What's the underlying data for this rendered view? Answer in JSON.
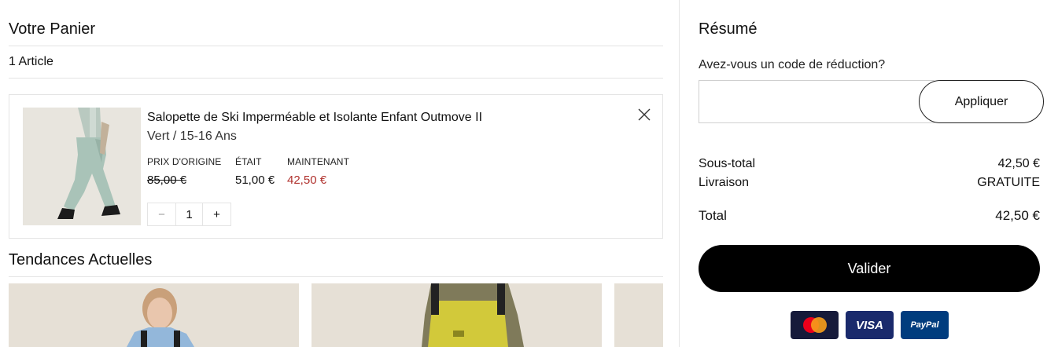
{
  "cart": {
    "title": "Votre Panier",
    "count": "1 Article",
    "item": {
      "name": "Salopette de Ski Imperméable et Isolante Enfant Outmove II",
      "variant": "Vert / 15-16 Ans",
      "prices": [
        {
          "label": "PRIX D'ORIGINE",
          "value": "85,00 €"
        },
        {
          "label": "ÉTAIT",
          "value": "51,00 €"
        },
        {
          "label": "MAINTENANT",
          "value": "42,50 €"
        }
      ],
      "quantity": "1",
      "minus": "−",
      "plus": "+"
    }
  },
  "trends": {
    "title": "Tendances Actuelles"
  },
  "summary": {
    "title": "Résumé",
    "promo_label": "Avez-vous un code de réduction?",
    "promo_placeholder": "",
    "apply": "Appliquer",
    "subtotal_label": "Sous-total",
    "subtotal_value": "42,50 €",
    "shipping_label": "Livraison",
    "shipping_value": "GRATUITE",
    "total_label": "Total",
    "total_value": "42,50 €",
    "checkout": "Valider"
  },
  "payments": {
    "visa": "VISA",
    "paypal": "PayPal"
  },
  "colors": {
    "sale": "#b0312d",
    "checkout_bg": "#000000",
    "border": "#e4e4e4"
  }
}
